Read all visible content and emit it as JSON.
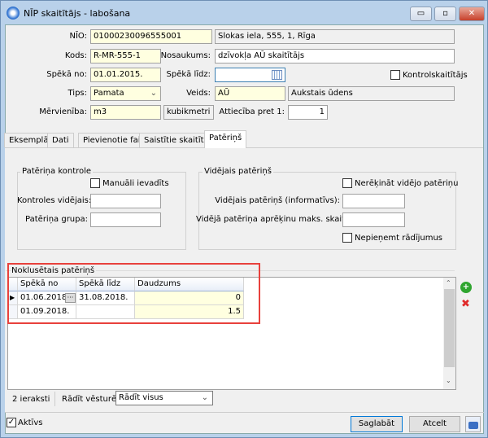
{
  "window": {
    "title": "NĪP skaitītājs - labošana",
    "minimize": "▭",
    "maximize": "▫",
    "close": "✕"
  },
  "form": {
    "nio_label": "NĪO:",
    "nio_value": "01000230096555001",
    "address": "Slokas iela, 555, 1, Rīga",
    "kods_label": "Kods:",
    "kods_value": "R-MR-555-1",
    "nosaukums_label": "Nosaukums:",
    "nosaukums_value": "dzīvokļa AŪ skaitītājs",
    "speka_no_label": "Spēkā no:",
    "speka_no_value": "01.01.2015.",
    "speka_lidz_label": "Spēkā līdz:",
    "speka_lidz_value": "",
    "kontrol_label": "Kontrolskaitītājs",
    "tips_label": "Tips:",
    "tips_value": "Pamata",
    "veids_label": "Veids:",
    "veids_value": "AŪ",
    "veids_desc": "Aukstais ūdens",
    "merv_label": "Mērvienība:",
    "merv_value": "m3",
    "merv_desc": "kubikmetri",
    "attieciba_label": "Attiecība pret 1:",
    "attieciba_value": "1"
  },
  "tabs": [
    {
      "label": "Eksemplāri"
    },
    {
      "label": "Dati"
    },
    {
      "label": "Pievienotie faili"
    },
    {
      "label": "Saistītie skaitītāji"
    },
    {
      "label": "Patēriņš"
    }
  ],
  "kontrole": {
    "title": "Patēriņa kontrole",
    "manual_label": "Manuāli ievadīts",
    "vid_label": "Kontroles vidējais:",
    "vid_value": "",
    "grupa_label": "Patēriņa grupa:",
    "grupa_value": ""
  },
  "videjais": {
    "title": "Vidējais patēriņš",
    "nerek_label": "Nerēķināt vidējo patēriņu",
    "info_label": "Vidējais patēriņš (informatīvs):",
    "info_value": "",
    "maks_label": "Vidējā patēriņa aprēķinu maks. skaits:",
    "maks_value": "",
    "nepien_label": "Nepieņemt rādījumus"
  },
  "grid": {
    "title": "Noklusētais patēriņš",
    "columns": [
      "Spēkā no",
      "Spēkā līdz",
      "Daudzums"
    ],
    "rows": [
      [
        "01.06.2018.",
        "31.08.2018.",
        "0"
      ],
      [
        "01.09.2018.",
        "",
        "1.5"
      ]
    ],
    "ellipsis": "···"
  },
  "status": {
    "count": "2 ieraksti",
    "history_label": "Rādīt vēsturē:",
    "history_value": "Rādīt visus"
  },
  "footer": {
    "aktivs_label": "Aktīvs",
    "save": "Saglabāt",
    "cancel": "Atcelt"
  },
  "colors": {
    "highlight": "#e8413c",
    "required": "#ffffe0"
  }
}
